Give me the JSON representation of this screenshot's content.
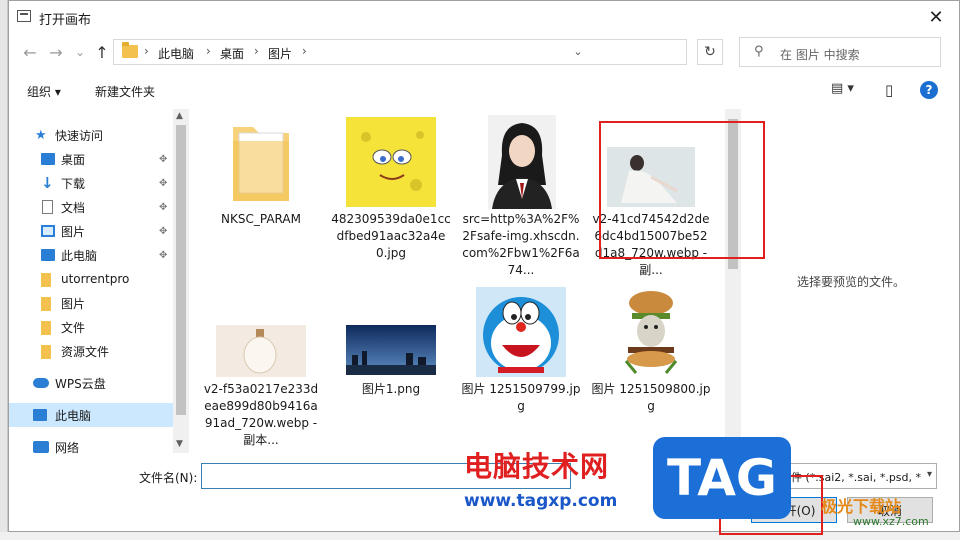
{
  "window": {
    "title": "打开画布",
    "close": "✕"
  },
  "nav": {
    "back": "←",
    "forward": "→",
    "dropdown": "⌄",
    "up": "↑",
    "breadcrumbs": [
      "此电脑",
      "桌面",
      "图片"
    ],
    "separator": "›",
    "refresh": "↻",
    "search_placeholder": "在 图片 中搜索"
  },
  "toolbar": {
    "organize": "组织 ▾",
    "new_folder": "新建文件夹",
    "view": "▤ ▾",
    "pane": "▯",
    "help": "?"
  },
  "sidebar": {
    "items": [
      {
        "label": "快速访问",
        "icon": "star-icon",
        "color": "#2a7fd4"
      },
      {
        "label": "桌面",
        "icon": "desktop-icon",
        "color": "#2a7fd4",
        "pinned": "📌"
      },
      {
        "label": "下载",
        "icon": "download-icon",
        "color": "#2a7fd4",
        "pinned": "📌"
      },
      {
        "label": "文档",
        "icon": "document-icon",
        "color": "#7a7a7a",
        "pinned": "📌"
      },
      {
        "label": "图片",
        "icon": "picture-icon",
        "color": "#2a7fd4",
        "pinned": "📌"
      },
      {
        "label": "此电脑",
        "icon": "computer-icon",
        "color": "#2a7fd4",
        "pinned": "📌"
      },
      {
        "label": "utorrentpro",
        "icon": "folder-icon",
        "color": "#f2c14e"
      },
      {
        "label": "图片",
        "icon": "folder-icon",
        "color": "#f2c14e"
      },
      {
        "label": "文件",
        "icon": "folder-icon",
        "color": "#f2c14e"
      },
      {
        "label": "资源文件",
        "icon": "folder-icon",
        "color": "#f2c14e"
      },
      {
        "label": "WPS云盘",
        "icon": "cloud-icon",
        "color": "#2a7fd4"
      },
      {
        "label": "此电脑",
        "icon": "computer-icon",
        "color": "#2a7fd4"
      },
      {
        "label": "网络",
        "icon": "network-icon",
        "color": "#2a7fd4"
      }
    ]
  },
  "files": [
    {
      "name": "NKSC_PARAM",
      "kind": "folder"
    },
    {
      "name": "482309539da0e1ccdfbed91aac32a4e0.jpg",
      "kind": "spongebob"
    },
    {
      "name": "src=http%3A%2F%2Fsafe-img.xhscdn.com%2Fbw1%2F6a74...",
      "kind": "portrait"
    },
    {
      "name": "v2-41cd74542d2de6dc4bd15007be52d1a8_720w.webp - 副...",
      "kind": "photo-light"
    },
    {
      "name": "v2-f53a0217e233deae899d80b9416a91ad_720w.webp - 副本...",
      "kind": "bottle"
    },
    {
      "name": "图片1.png",
      "kind": "cityscape"
    },
    {
      "name": "图片 1251509799.jpg",
      "kind": "doraemon"
    },
    {
      "name": "图片 1251509800.jpg",
      "kind": "burger-cat"
    }
  ],
  "preview": {
    "text": "选择要预览的文件。"
  },
  "footer": {
    "filename_label": "文件名(N):",
    "filename_value": "",
    "filter": "画布文件 (*.sai2, *.sai, *.psd, *",
    "open": "打开(O)",
    "cancel": "取消"
  },
  "watermark": {
    "cn": "电脑技术网",
    "url": "www.tagxp.com",
    "tag": "TAG",
    "brand": "极光下载站",
    "site": "www.xz7.com"
  },
  "colors": {
    "selection": "#cce8ff",
    "highlight_box": "#e0201d",
    "accent": "#0078d7"
  }
}
